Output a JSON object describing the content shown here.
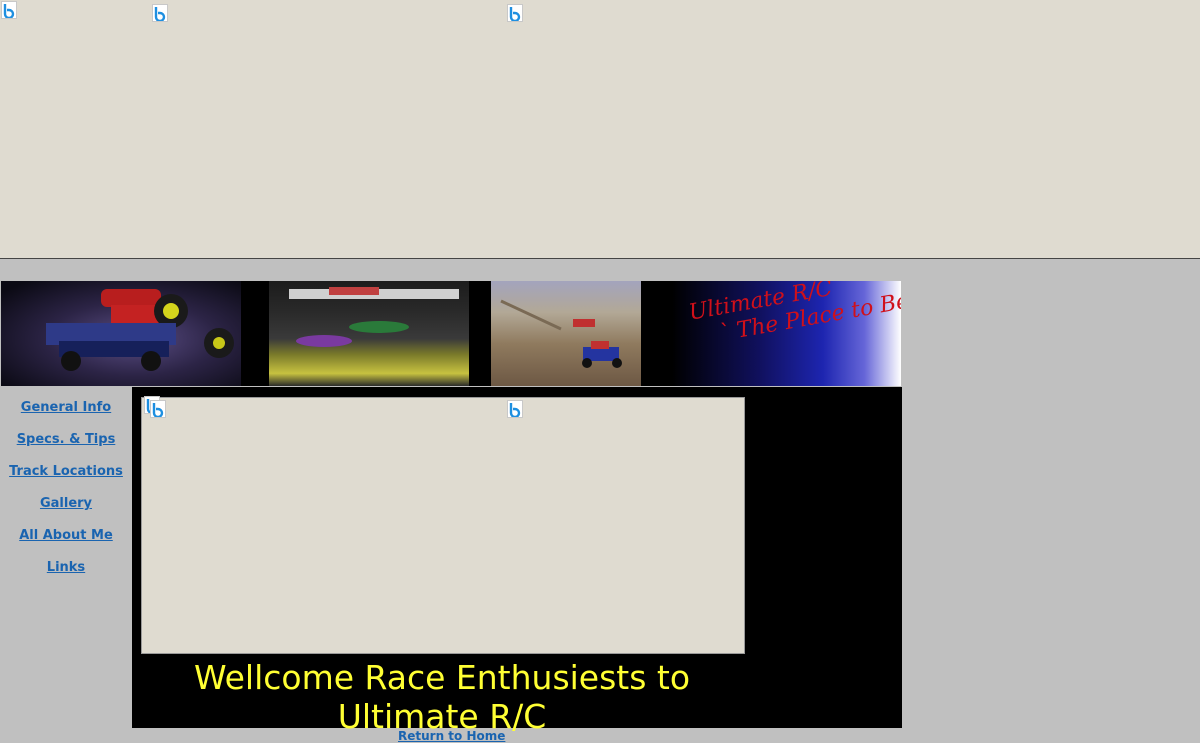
{
  "nav": {
    "items": [
      {
        "label": "General Info"
      },
      {
        "label": "Specs. & Tips"
      },
      {
        "label": "Track Locations"
      },
      {
        "label": "Gallery"
      },
      {
        "label": "All About Me"
      },
      {
        "label": "Links"
      }
    ]
  },
  "banner": {
    "title_line1": "Ultimate R/C",
    "title_line2": "` The Place to Be'"
  },
  "main": {
    "welcome": "Wellcome Race Enthusiests to Ultimate R/C"
  },
  "footer": {
    "return_label": "Return to Home"
  },
  "icons": {
    "ad_badge": "bing-b-icon"
  },
  "colors": {
    "page_bg": "#c0c0c0",
    "ad_bg": "#dfdbd0",
    "link": "#1a64b0",
    "welcome_text": "#ffff33",
    "banner_title": "#d0101a"
  }
}
